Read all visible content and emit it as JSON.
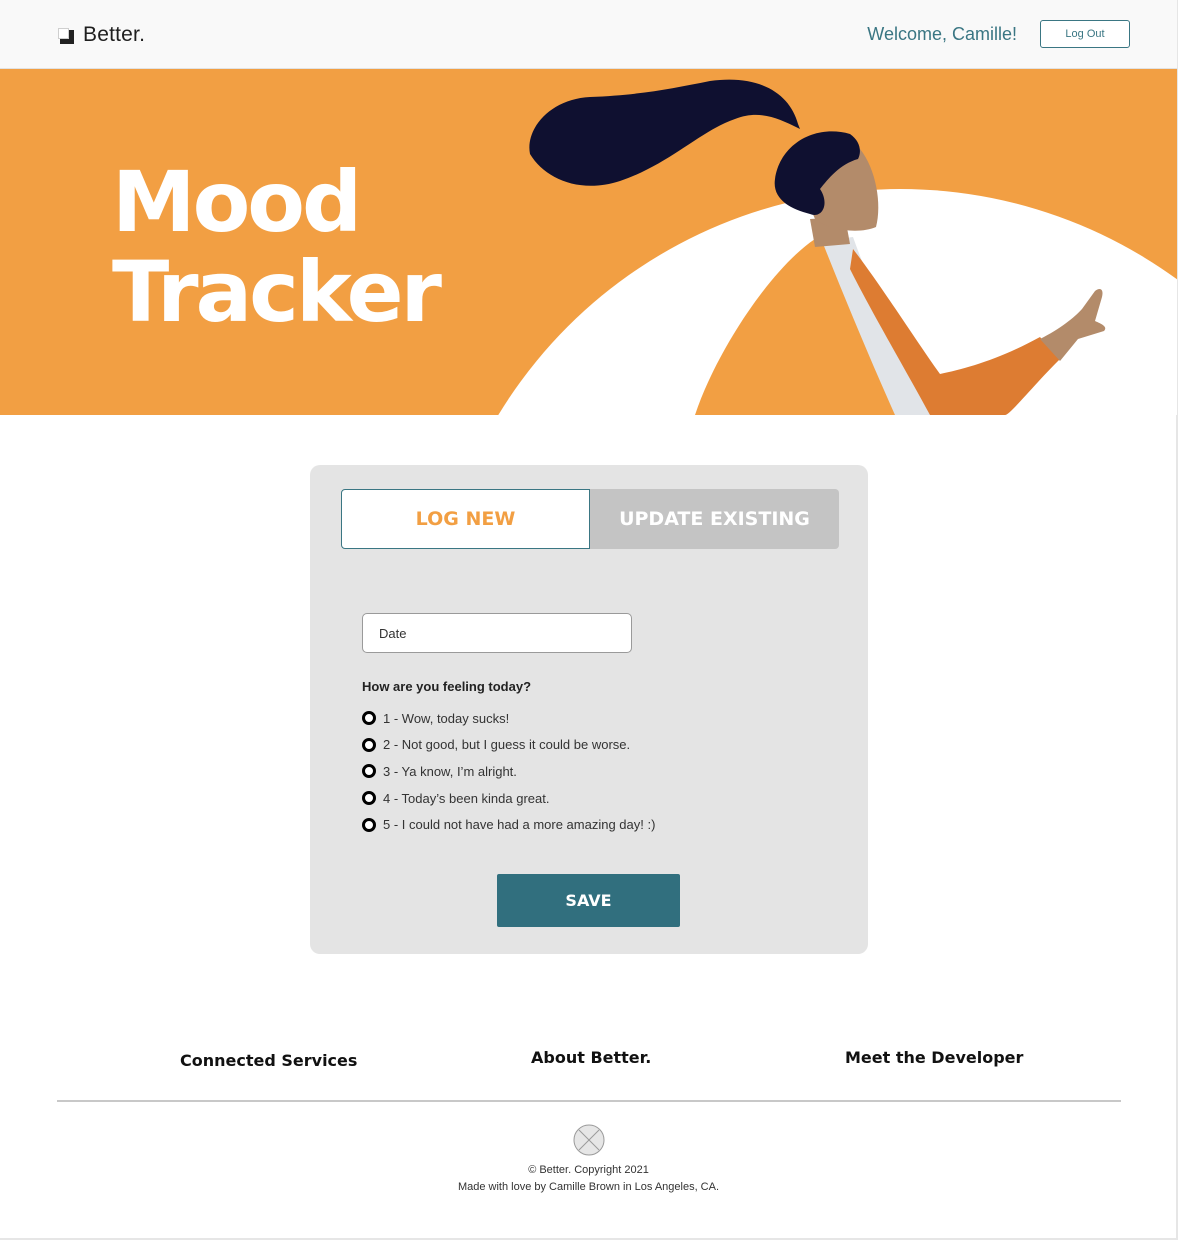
{
  "header": {
    "brand": "Better.",
    "welcome": "Welcome, Camille!",
    "logout_label": "Log Out"
  },
  "hero": {
    "title_line1": "Mood",
    "title_line2": "Tracker",
    "colors": {
      "background": "#f29f43",
      "accent_circle": "#ffffff",
      "hair": "#0f1030",
      "skin": "#b38b6a",
      "jacket": "#f29f43",
      "jacket_shadow": "#dd7c32",
      "shirt": "#e1e4e8"
    }
  },
  "form": {
    "tabs": [
      {
        "label": "LOG NEW",
        "active": true
      },
      {
        "label": "UPDATE EXISTING",
        "active": false
      }
    ],
    "date_placeholder": "Date",
    "question": "How are you feeling today?",
    "options": [
      "1 - Wow, today sucks!",
      "2 - Not good, but I guess it could be worse.",
      "3 - Ya know, I’m alright.",
      "4 - Today’s been kinda great.",
      "5 - I could not have had a more amazing day! :)"
    ],
    "save_label": "SAVE"
  },
  "footer": {
    "links": [
      "Connected Services",
      "About Better.",
      "Meet the Developer"
    ],
    "copyright": "© Better. Copyright 2021",
    "made_with": "Made with love by Camille Brown in Los Angeles, CA."
  },
  "colors": {
    "primary": "#316f7e",
    "accent": "#f29f43",
    "card_bg": "#e4e4e4"
  }
}
